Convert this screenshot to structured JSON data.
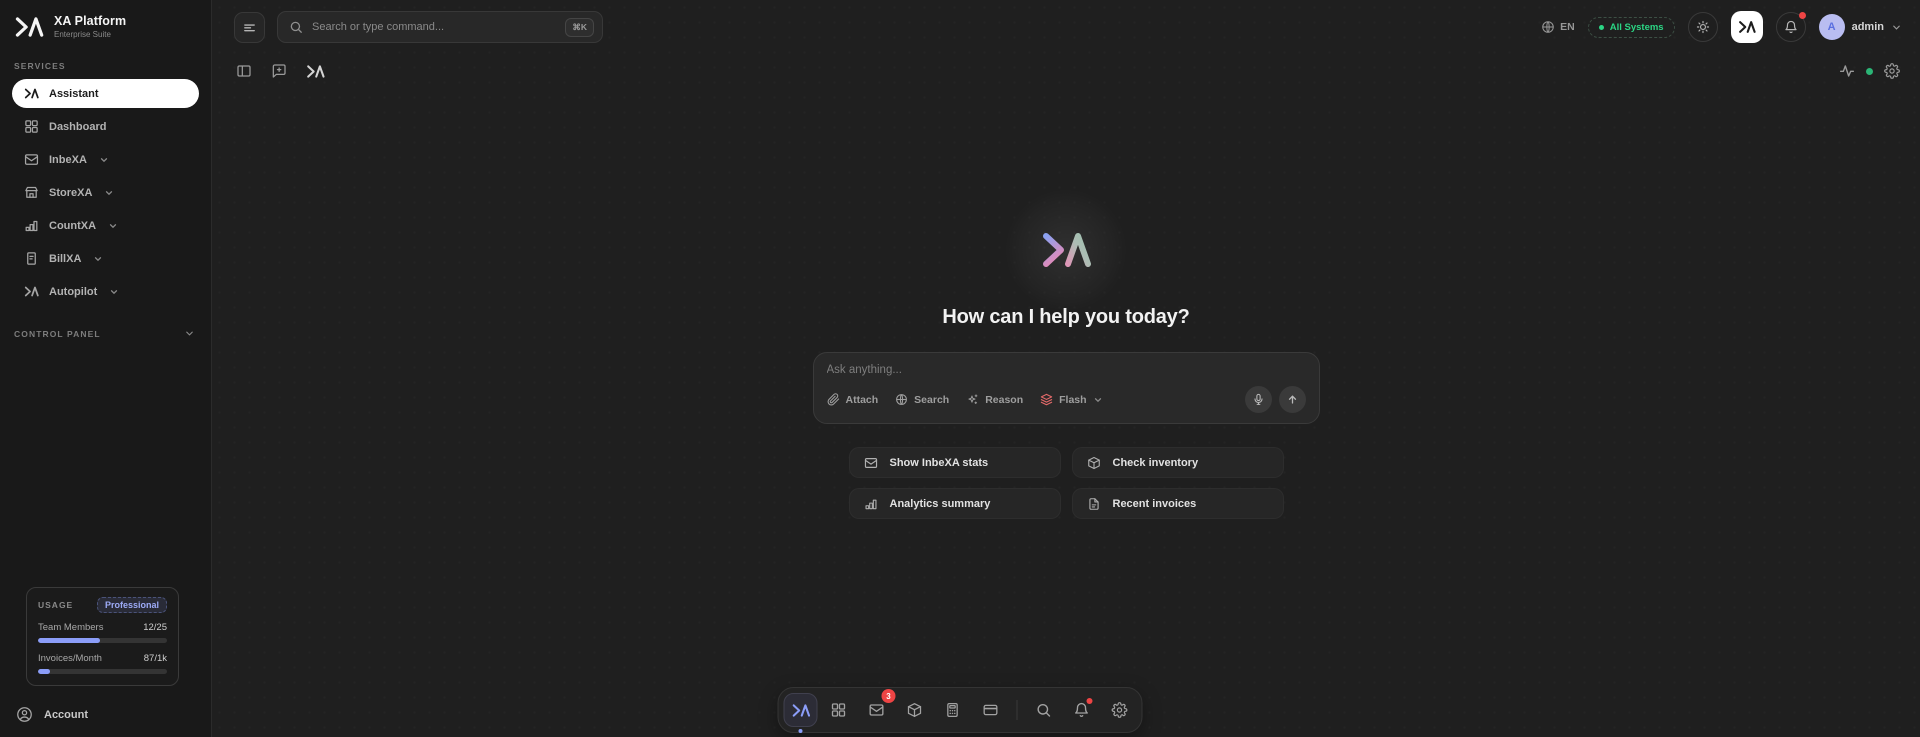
{
  "brand": {
    "name": "XA Platform",
    "subtitle": "Enterprise Suite",
    "logo_icon": "xa-chevron-lambda"
  },
  "header": {
    "search": {
      "placeholder": "Search or type command...",
      "shortcut": "⌘K",
      "icon": "search-icon"
    },
    "language": "EN",
    "system_status": "All Systems",
    "username": "admin",
    "avatar_initial": "A",
    "icons": [
      "globe-icon",
      "sun-icon",
      "xa-logo-icon",
      "bell-icon"
    ]
  },
  "sidebar": {
    "services_label": "SERVICES",
    "items": [
      {
        "label": "Assistant",
        "icon": "xa-logo-icon",
        "active": true,
        "expandable": false
      },
      {
        "label": "Dashboard",
        "icon": "grid-icon",
        "active": false,
        "expandable": false
      },
      {
        "label": "InbeXA",
        "icon": "mail-icon",
        "active": false,
        "expandable": true
      },
      {
        "label": "StoreXA",
        "icon": "storefront-icon",
        "active": false,
        "expandable": true
      },
      {
        "label": "CountXA",
        "icon": "bar-chart-icon",
        "active": false,
        "expandable": true
      },
      {
        "label": "BillXA",
        "icon": "receipt-icon",
        "active": false,
        "expandable": true
      },
      {
        "label": "Autopilot",
        "icon": "xa-logo-icon",
        "active": false,
        "expandable": true
      }
    ],
    "control_panel_label": "CONTROL PANEL",
    "usage": {
      "title": "USAGE",
      "plan_badge": "Professional",
      "metric1_label": "Team Members",
      "metric1_value": "12/25",
      "metric1_percent": 48,
      "metric2_label": "Invoices/Month",
      "metric2_value": "87/1k",
      "metric2_percent": 9
    },
    "account_label": "Account"
  },
  "toolbar": {
    "left_icons": [
      "panel-left-icon",
      "new-chat-icon",
      "xa-logo-icon"
    ],
    "right_icons": [
      "activity-icon",
      "status-green-dot",
      "gear-icon"
    ]
  },
  "main": {
    "heading": "How can I help you today?",
    "input_placeholder": "Ask anything...",
    "actions": {
      "attach": "Attach",
      "search": "Search",
      "reason": "Reason",
      "model": "Flash"
    },
    "suggestions": [
      {
        "label": "Show InbeXA stats",
        "icon": "mail-icon"
      },
      {
        "label": "Check inventory",
        "icon": "package-icon"
      },
      {
        "label": "Analytics summary",
        "icon": "bar-chart-icon"
      },
      {
        "label": "Recent invoices",
        "icon": "file-icon"
      }
    ]
  },
  "dock": {
    "mail_badge": "3",
    "items": [
      "xa-assistant",
      "dashboard",
      "mail",
      "package",
      "calculator",
      "billing-card",
      "search",
      "notifications",
      "settings"
    ]
  },
  "colors": {
    "accent": "#8b9df8",
    "green": "#2bd584",
    "red": "#ee4444",
    "active_pill": "#ffffff"
  }
}
